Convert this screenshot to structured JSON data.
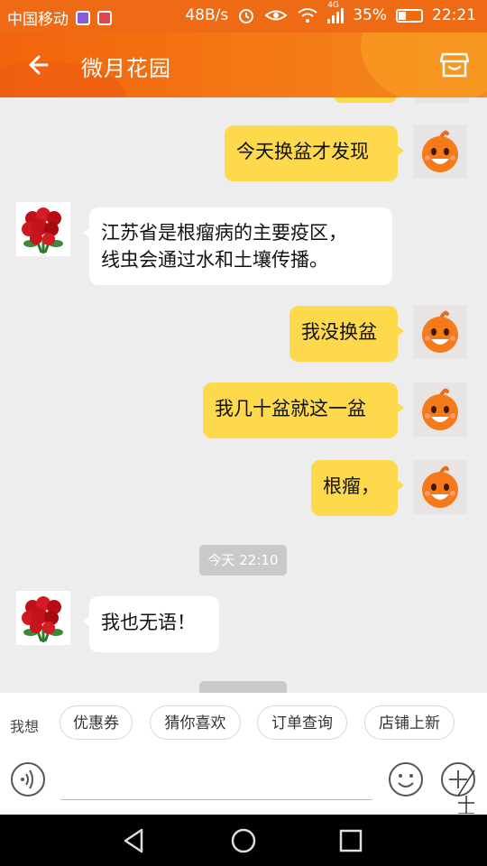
{
  "status_bar": {
    "carrier": "中国移动",
    "speed": "48B/s",
    "network_type": "4G",
    "battery_percent": "35%",
    "battery_level": 0.35,
    "time": "22:21"
  },
  "header": {
    "title": "微月花园",
    "back_icon": "arrow-left-icon",
    "store_icon": "store-icon"
  },
  "messages": [
    {
      "side": "me",
      "text": "今天换盆才发现"
    },
    {
      "side": "them",
      "text": "江苏省是根瘤病的主要疫区，\n线虫会通过水和土壤传播。"
    },
    {
      "side": "me",
      "text": "我没换盆"
    },
    {
      "side": "me",
      "text": "我几十盆就这一盆"
    },
    {
      "side": "me",
      "text": "根瘤，"
    },
    {
      "side": "them",
      "text": "我也无语！"
    }
  ],
  "timestamp": "今天 22:10",
  "suggestions": {
    "label": "我想",
    "chips": [
      "优惠券",
      "猜你喜欢",
      "订单查询",
      "店铺上新"
    ]
  },
  "input": {
    "value": "",
    "voice_icon": "voice-icon",
    "emoji_icon": "emoji-icon",
    "plus_icon": "plus-icon"
  },
  "navbar": [
    "back-triangle-icon",
    "home-circle-icon",
    "recents-square-icon"
  ],
  "colors": {
    "accent": "#f47a16",
    "my_bubble": "#fed94b",
    "their_bubble": "#ffffff",
    "background": "#ededed"
  }
}
